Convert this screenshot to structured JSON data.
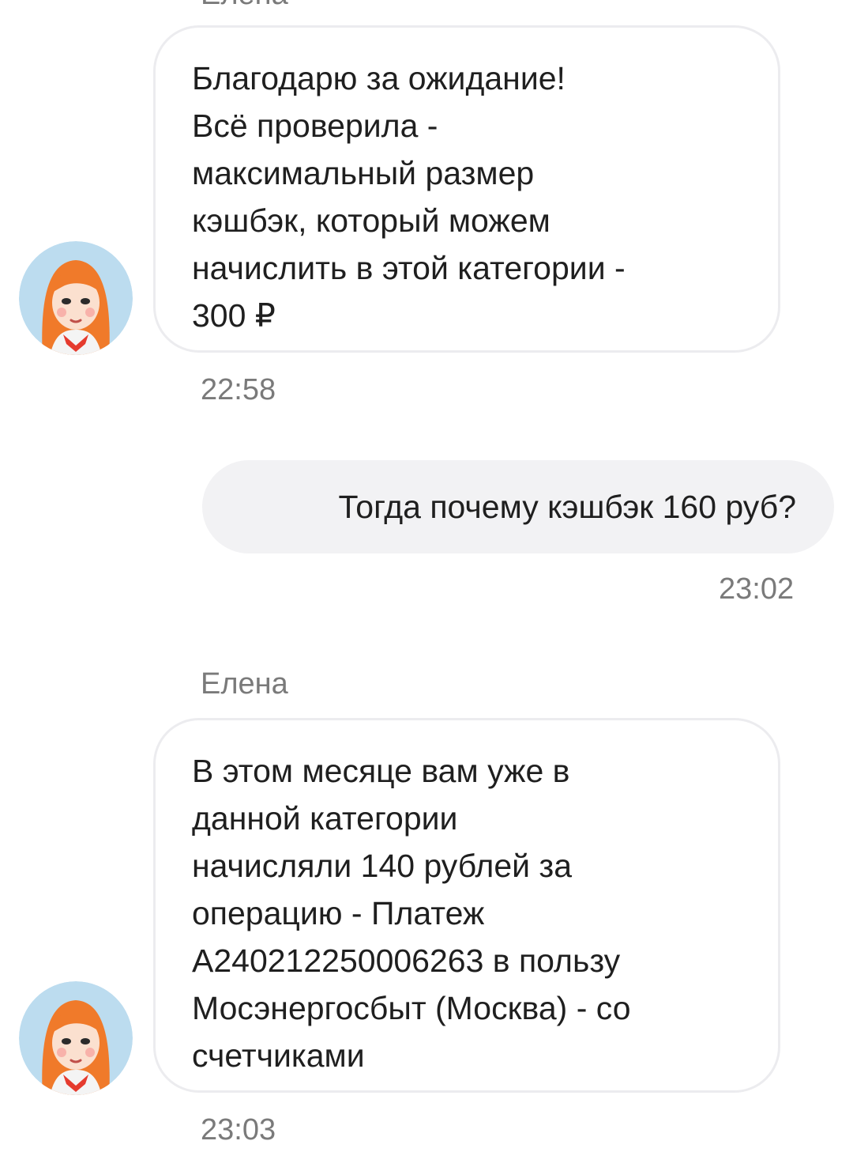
{
  "chat": {
    "messages": [
      {
        "direction": "incoming",
        "sender": "Елена",
        "text": "Благодарю за ожидание!\nВсё проверила -\nмаксимальный размер\nкэшбэк, который можем\nначислить в этой категории -\n300 ₽",
        "time": "22:58"
      },
      {
        "direction": "outgoing",
        "text": "Тогда почему кэшбэк 160 руб?",
        "time": "23:02"
      },
      {
        "direction": "incoming",
        "sender": "Елена",
        "text": "В этом месяце вам уже в\nданной категории\nначисляли 140 рублей за\nоперацию - Платеж\nA240212250006263 в пользу\nМосэнергосбыт (Москва) - со\nсчетчиками",
        "time": "23:03"
      }
    ]
  },
  "colors": {
    "incoming_bubble_border": "#ececef",
    "outgoing_bubble_bg": "#f2f2f4",
    "meta_text": "#7a7a7a",
    "avatar_bg": "#bcdcef",
    "avatar_hair": "#f07a2a"
  }
}
